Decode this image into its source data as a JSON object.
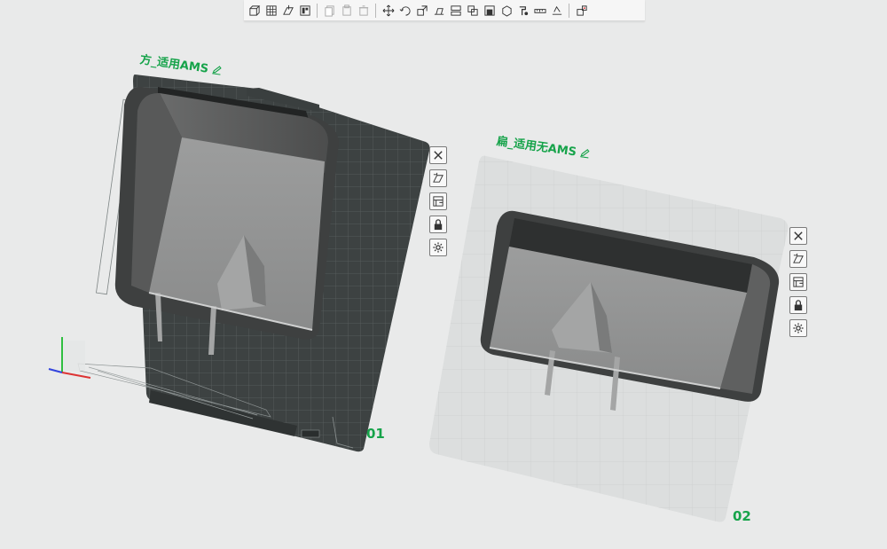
{
  "toolbar": {
    "items": [
      {
        "icon": "add-object-icon"
      },
      {
        "icon": "add-plate-icon"
      },
      {
        "icon": "orient-icon"
      },
      {
        "icon": "arrange-icon"
      },
      {
        "sep": true
      },
      {
        "icon": "copy-icon"
      },
      {
        "icon": "paste-icon"
      },
      {
        "icon": "delete-icon"
      },
      {
        "sep": true
      },
      {
        "icon": "move-icon"
      },
      {
        "icon": "rotate-icon"
      },
      {
        "icon": "scale-icon"
      },
      {
        "icon": "lay-on-face-icon"
      },
      {
        "icon": "cut-icon"
      },
      {
        "icon": "boolean-icon"
      },
      {
        "icon": "support-paint-icon"
      },
      {
        "icon": "seam-paint-icon"
      },
      {
        "icon": "color-paint-icon"
      },
      {
        "icon": "measure-icon"
      },
      {
        "icon": "text-icon"
      },
      {
        "sep": true
      },
      {
        "icon": "assembly-icon"
      }
    ]
  },
  "plates": [
    {
      "name": "方_适用AMS",
      "number": "01",
      "theme": "dark-textured"
    },
    {
      "name": "扁_适用无AMS",
      "number": "02",
      "theme": "light"
    }
  ],
  "plate_tools": [
    {
      "icon": "close-icon"
    },
    {
      "icon": "auto-orient-icon"
    },
    {
      "icon": "arrange-plate-icon"
    },
    {
      "icon": "lock-icon"
    },
    {
      "icon": "settings-icon"
    }
  ],
  "colors": {
    "accent": "#16a34a",
    "plate_dark": "#3d4242",
    "plate_light": "#dcdede",
    "model": "#8d8e8e",
    "background": "#e9eaea"
  }
}
